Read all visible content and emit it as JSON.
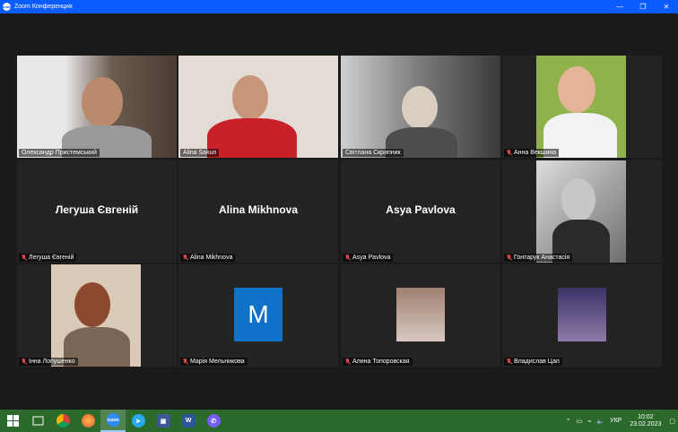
{
  "window": {
    "title": "Zoom Конференция",
    "logo": "zoom",
    "minimize": "—",
    "restore": "❐",
    "close": "✕"
  },
  "tiles": [
    {
      "name": "Олександр Пристемський",
      "muted": false,
      "active": true
    },
    {
      "name": "Alina Sakun",
      "muted": false
    },
    {
      "name": "Світлана Скрипник",
      "muted": false
    },
    {
      "name": "Анна Векшина",
      "muted": true
    },
    {
      "name": "Легуша Євгеній",
      "display": "Легуша Євгеній",
      "muted": true
    },
    {
      "name": "Alina Mikhnova",
      "display": "Alina Mikhnova",
      "muted": true
    },
    {
      "name": "Asya Pavlova",
      "display": "Asya Pavlova",
      "muted": true
    },
    {
      "name": "Гонтарук Анастасія",
      "muted": true
    },
    {
      "name": "Інна Лопушенко",
      "muted": true
    },
    {
      "name": "Марія Мельникова",
      "avatar_letter": "M",
      "muted": true
    },
    {
      "name": "Алина Топоровская",
      "muted": true
    },
    {
      "name": "Владислав Цап",
      "muted": true
    }
  ],
  "taskbar": {
    "apps": [
      "windows-icon",
      "task-view-icon",
      "chrome-icon",
      "firefox-icon",
      "zoom-icon",
      "telegram-icon",
      "save-icon",
      "word-icon",
      "viber-icon"
    ],
    "zoom_label": "zoom",
    "word_label": "W",
    "keyboard_lang": "УКР",
    "time": "10:02",
    "date": "23.02.2023"
  },
  "colors": {
    "titlebar": "#0b5cff",
    "active_speaker": "#c5dc5a",
    "taskbar": "#2b6a2b",
    "avatar_bg": "#0e72c8"
  }
}
